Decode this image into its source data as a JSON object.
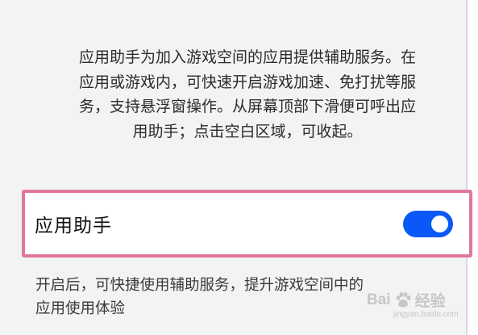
{
  "intro": {
    "lines": [
      "应用助手为加入游戏空间的应用提供辅助服务。在",
      "应用或游戏内，可快速开启游戏加速、免打扰等服",
      "务，支持悬浮窗操作。从屏幕顶部下滑便可呼出应",
      "用助手；点击空白区域，可收起。"
    ]
  },
  "toggle": {
    "label": "应用助手",
    "state": "on",
    "accent_color": "#0a59f7"
  },
  "description": {
    "lines": [
      "开启后，可快捷使用辅助服务，提升游戏空间中的",
      "应用使用体验"
    ]
  },
  "highlight_color": "#e2779c",
  "watermark": {
    "brand_left": "Bai",
    "brand_right": "经验",
    "icon": "baidu-paw-icon",
    "sub": "jingyan.baidu.com"
  }
}
